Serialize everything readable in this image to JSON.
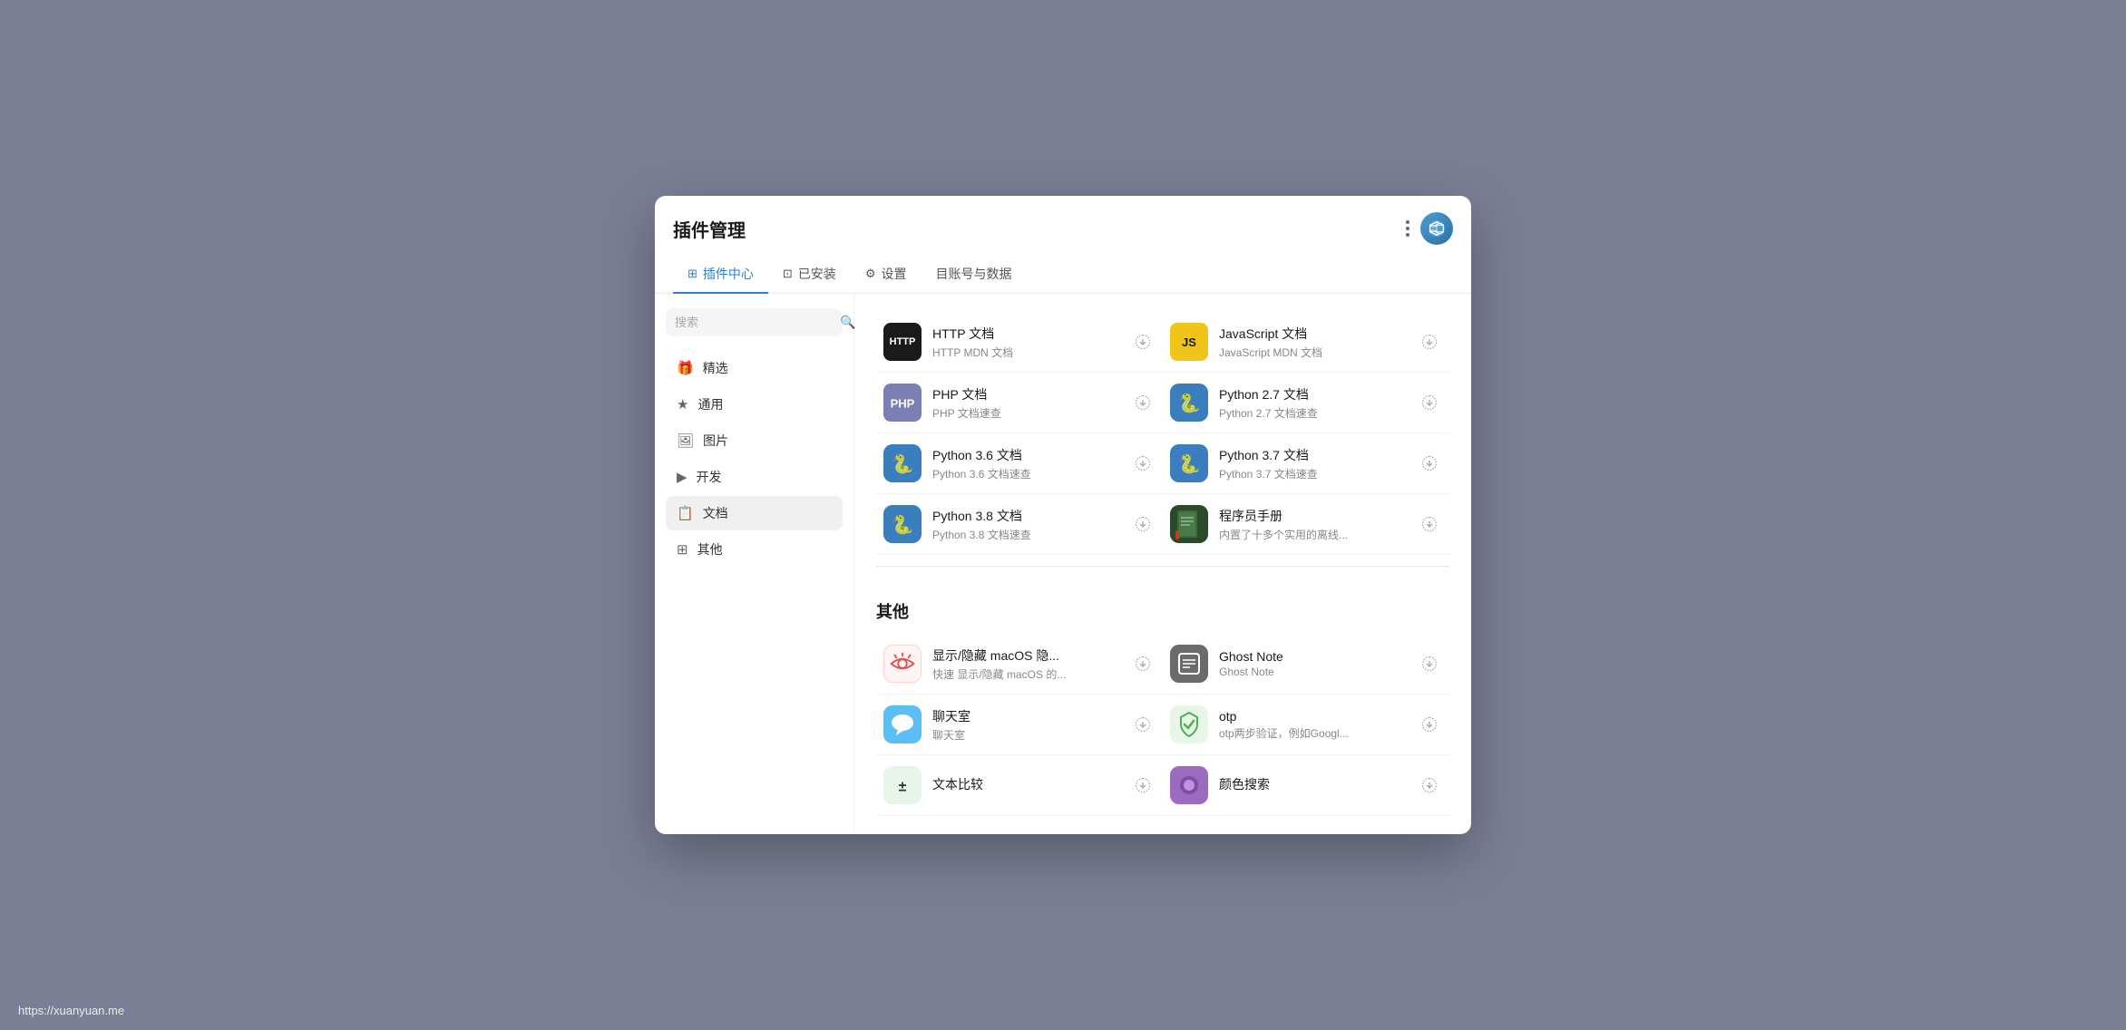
{
  "window": {
    "title": "插件管理"
  },
  "tabs": [
    {
      "id": "plugin-center",
      "label": "插件中心",
      "icon": "⊞",
      "active": true
    },
    {
      "id": "installed",
      "label": "已安装",
      "icon": "⊡"
    },
    {
      "id": "settings",
      "label": "设置",
      "icon": "⚙"
    },
    {
      "id": "account",
      "label": "目账号与数据",
      "icon": ""
    }
  ],
  "sidebar": {
    "search_placeholder": "搜索",
    "items": [
      {
        "id": "featured",
        "label": "精选",
        "icon": "🎁"
      },
      {
        "id": "general",
        "label": "通用",
        "icon": "★"
      },
      {
        "id": "images",
        "label": "图片",
        "icon": "🖼"
      },
      {
        "id": "dev",
        "label": "开发",
        "icon": "▶"
      },
      {
        "id": "docs",
        "label": "文档",
        "icon": "📋",
        "active": true
      },
      {
        "id": "others",
        "label": "其他",
        "icon": "⊞"
      }
    ]
  },
  "docs_section": {
    "plugins": [
      {
        "id": "http",
        "name": "HTTP 文档",
        "desc": "HTTP MDN 文档",
        "logo_type": "http",
        "logo_text": "HTTP"
      },
      {
        "id": "js",
        "name": "JavaScript 文档",
        "desc": "JavaScript MDN 文档",
        "logo_type": "js",
        "logo_text": "JS"
      },
      {
        "id": "php",
        "name": "PHP 文档",
        "desc": "PHP 文档速查",
        "logo_type": "php",
        "logo_text": "php"
      },
      {
        "id": "py27",
        "name": "Python 2.7 文档",
        "desc": "Python 2.7 文档速查",
        "logo_type": "py",
        "logo_text": "py"
      },
      {
        "id": "py36",
        "name": "Python 3.6 文档",
        "desc": "Python 3.6 文档速查",
        "logo_type": "py",
        "logo_text": "py"
      },
      {
        "id": "py37",
        "name": "Python 3.7 文档",
        "desc": "Python 3.7 文档速查",
        "logo_type": "py",
        "logo_text": "py"
      },
      {
        "id": "py38",
        "name": "Python 3.8 文档",
        "desc": "Python 3.8 文档速查",
        "logo_type": "py",
        "logo_text": "py"
      },
      {
        "id": "handbook",
        "name": "程序员手册",
        "desc": "内置了十多个实用的离线...",
        "logo_type": "handbook",
        "logo_text": "📗"
      }
    ]
  },
  "others_section": {
    "title": "其他",
    "plugins": [
      {
        "id": "hide-macos",
        "name": "显示/隐藏 macOS 隐...",
        "desc": "快速 显示/隐藏 macOS 的...",
        "logo_type": "hide",
        "logo_text": "〰"
      },
      {
        "id": "ghost-note",
        "name": "Ghost Note",
        "desc": "Ghost Note",
        "logo_type": "ghost",
        "logo_text": "📋"
      },
      {
        "id": "chat",
        "name": "聊天室",
        "desc": "聊天室",
        "logo_type": "chat",
        "logo_text": "💬"
      },
      {
        "id": "otp",
        "name": "otp",
        "desc": "otp两步验证，例如Googl...",
        "logo_type": "otp",
        "logo_text": "✓"
      },
      {
        "id": "textdiff",
        "name": "文本比较",
        "desc": "",
        "logo_type": "textdiff",
        "logo_text": "±"
      },
      {
        "id": "color-search",
        "name": "颜色搜索",
        "desc": "",
        "logo_type": "color",
        "logo_text": "●"
      }
    ]
  },
  "watermark": "https://xuanyuan.me"
}
